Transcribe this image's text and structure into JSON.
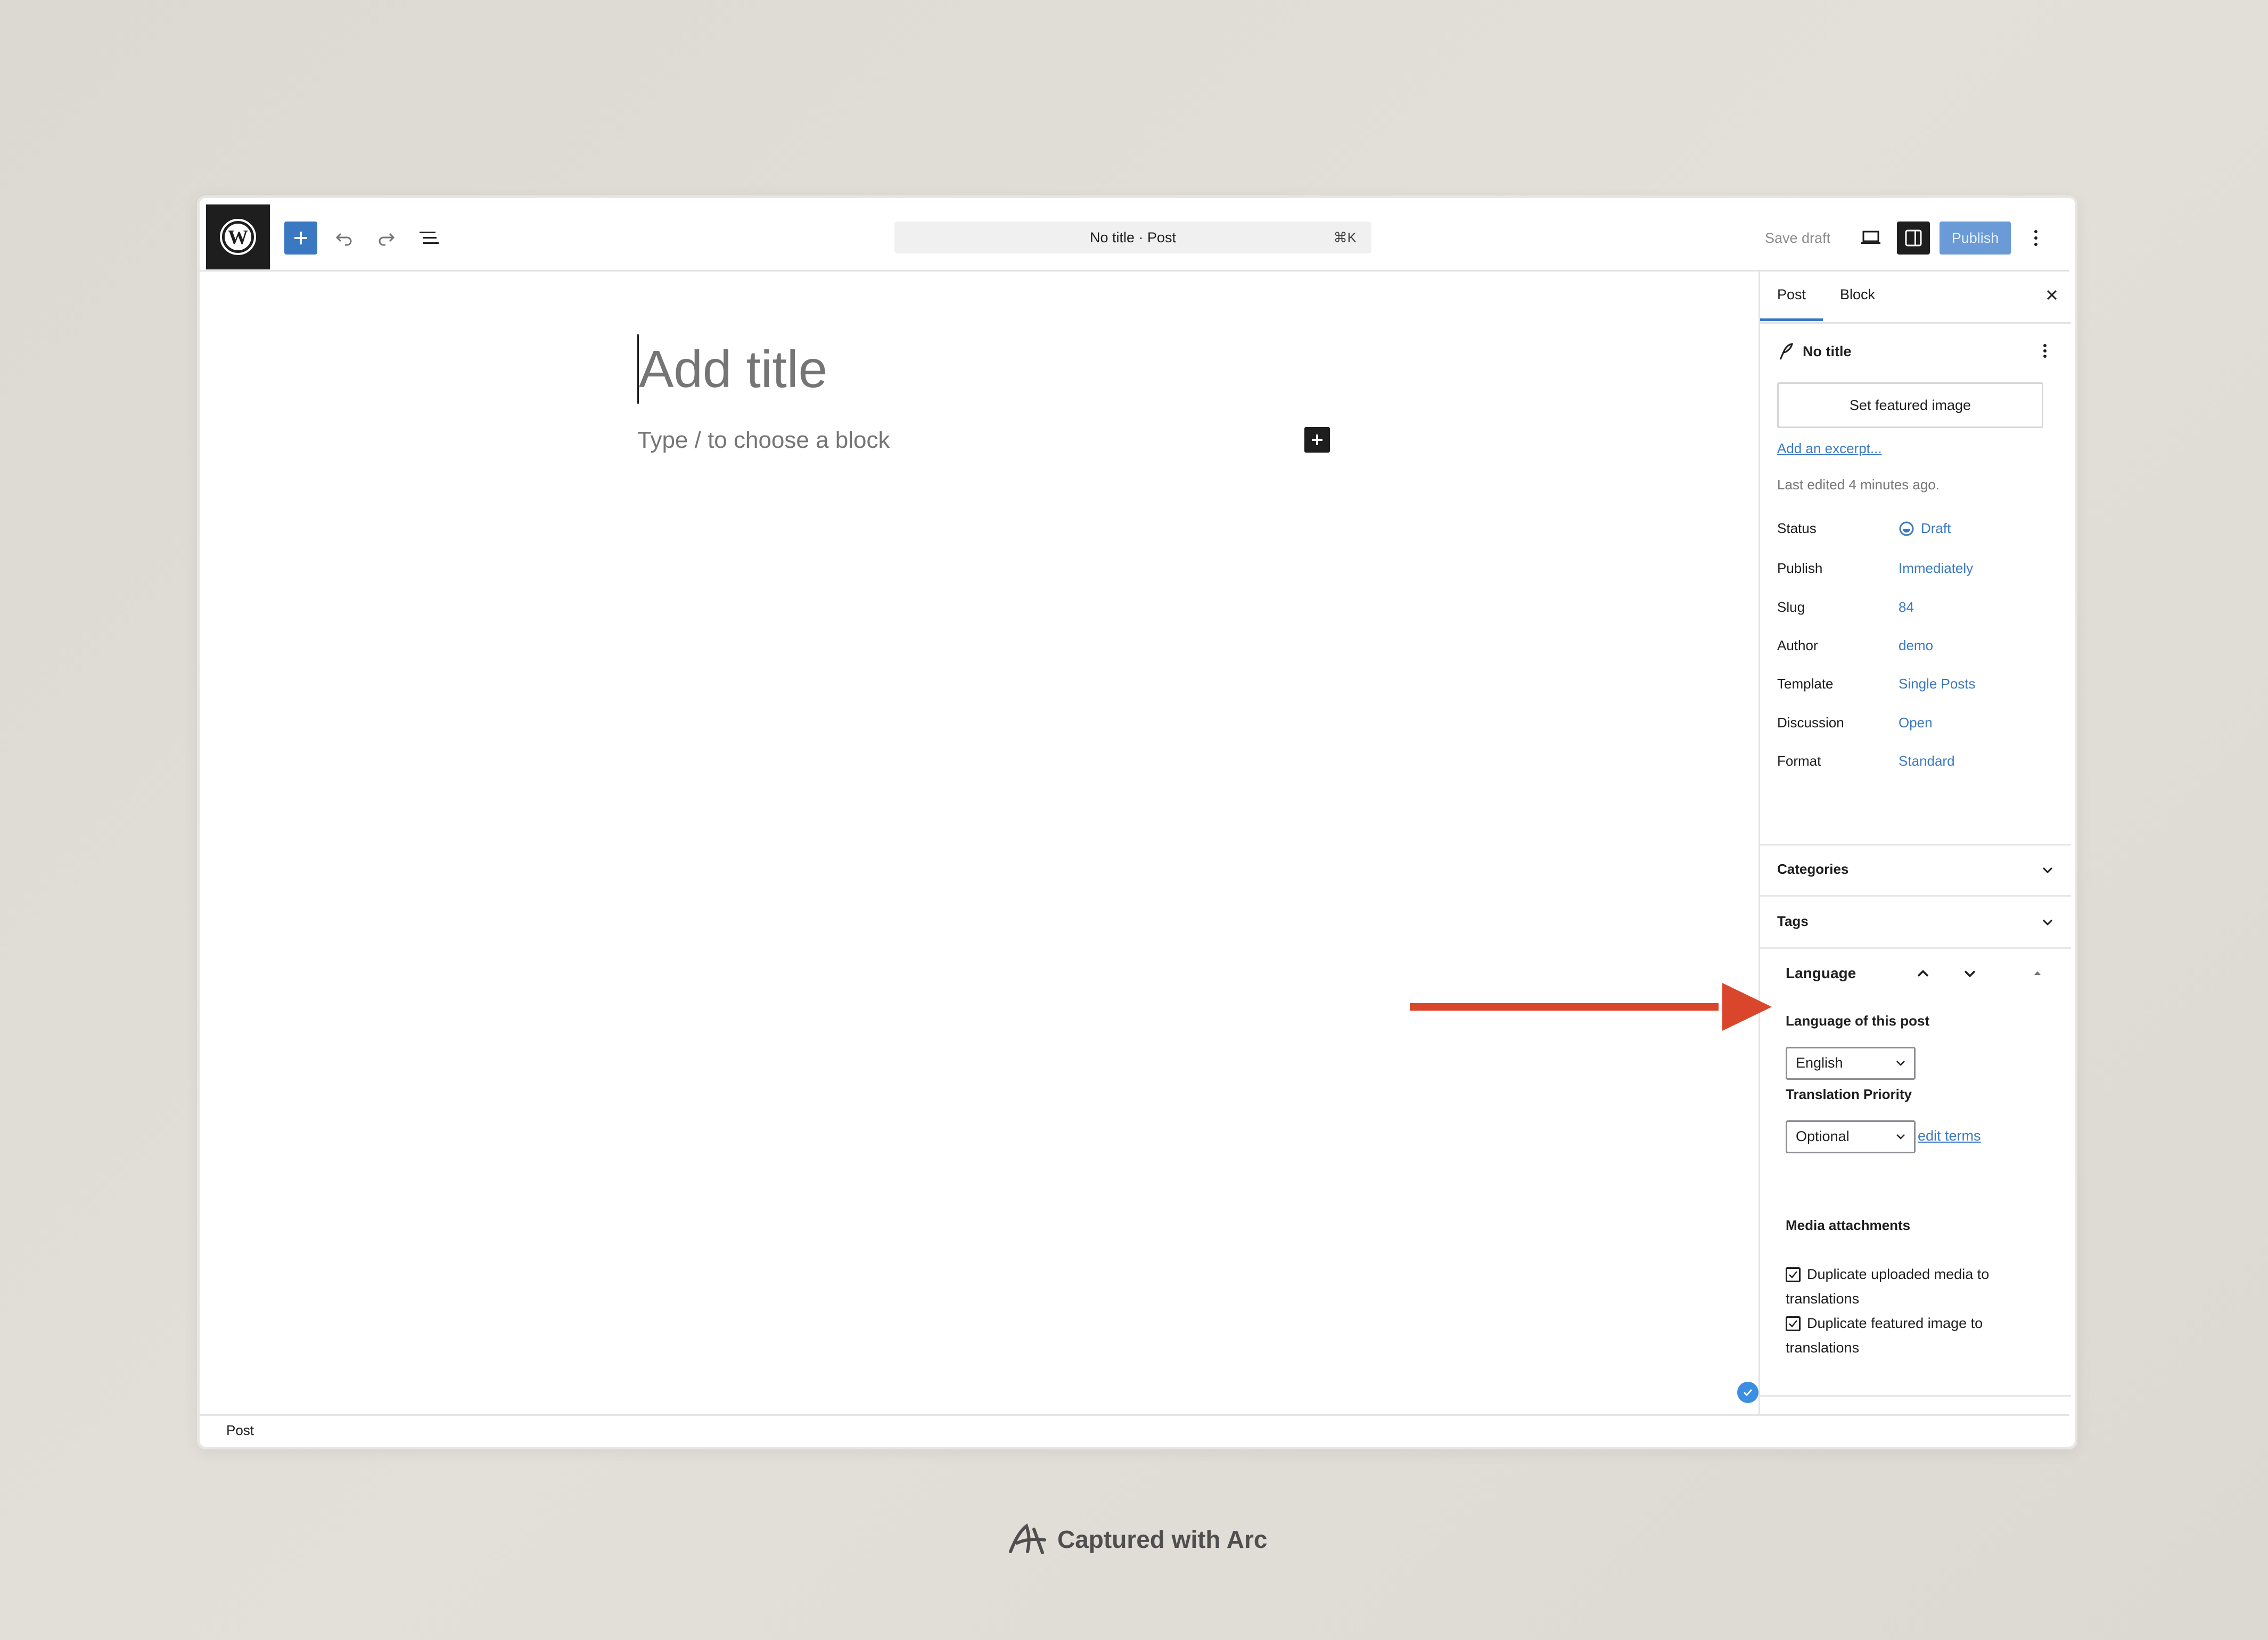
{
  "toolbar": {
    "add_block": "plus-icon",
    "document_title": "No title · Post",
    "shortcut": "⌘K",
    "save_draft_label": "Save draft",
    "publish_label": "Publish"
  },
  "editor": {
    "title_placeholder": "Add title",
    "block_placeholder": "Type / to choose a block"
  },
  "statusbar": {
    "label": "Post"
  },
  "sidebar": {
    "tabs": [
      {
        "label": "Post",
        "active": true
      },
      {
        "label": "Block",
        "active": false
      }
    ],
    "post_title": "No title",
    "featured_image_label": "Set featured image",
    "excerpt_link": "Add an excerpt...",
    "last_edited": "Last edited 4 minutes ago.",
    "meta": [
      {
        "label": "Status",
        "value": "Draft"
      },
      {
        "label": "Publish",
        "value": "Immediately"
      },
      {
        "label": "Slug",
        "value": "84"
      },
      {
        "label": "Author",
        "value": "demo"
      },
      {
        "label": "Template",
        "value": "Single Posts"
      },
      {
        "label": "Discussion",
        "value": "Open"
      },
      {
        "label": "Format",
        "value": "Standard"
      }
    ],
    "panels": [
      {
        "label": "Categories"
      },
      {
        "label": "Tags"
      }
    ],
    "language": {
      "title": "Language",
      "language_label": "Language of this post",
      "language_value": "English",
      "priority_label": "Translation Priority",
      "priority_value": "Optional",
      "edit_terms": "edit terms",
      "media_title": "Media attachments",
      "checkboxes": [
        {
          "label": "Duplicate uploaded media to translations",
          "checked": true
        },
        {
          "label": "Duplicate featured image to translations",
          "checked": true
        }
      ]
    }
  },
  "footer": {
    "text": "Captured with Arc"
  },
  "colors": {
    "accent": "#3a79c2",
    "arrow": "#d9462b",
    "background": "#dcd8d2"
  }
}
